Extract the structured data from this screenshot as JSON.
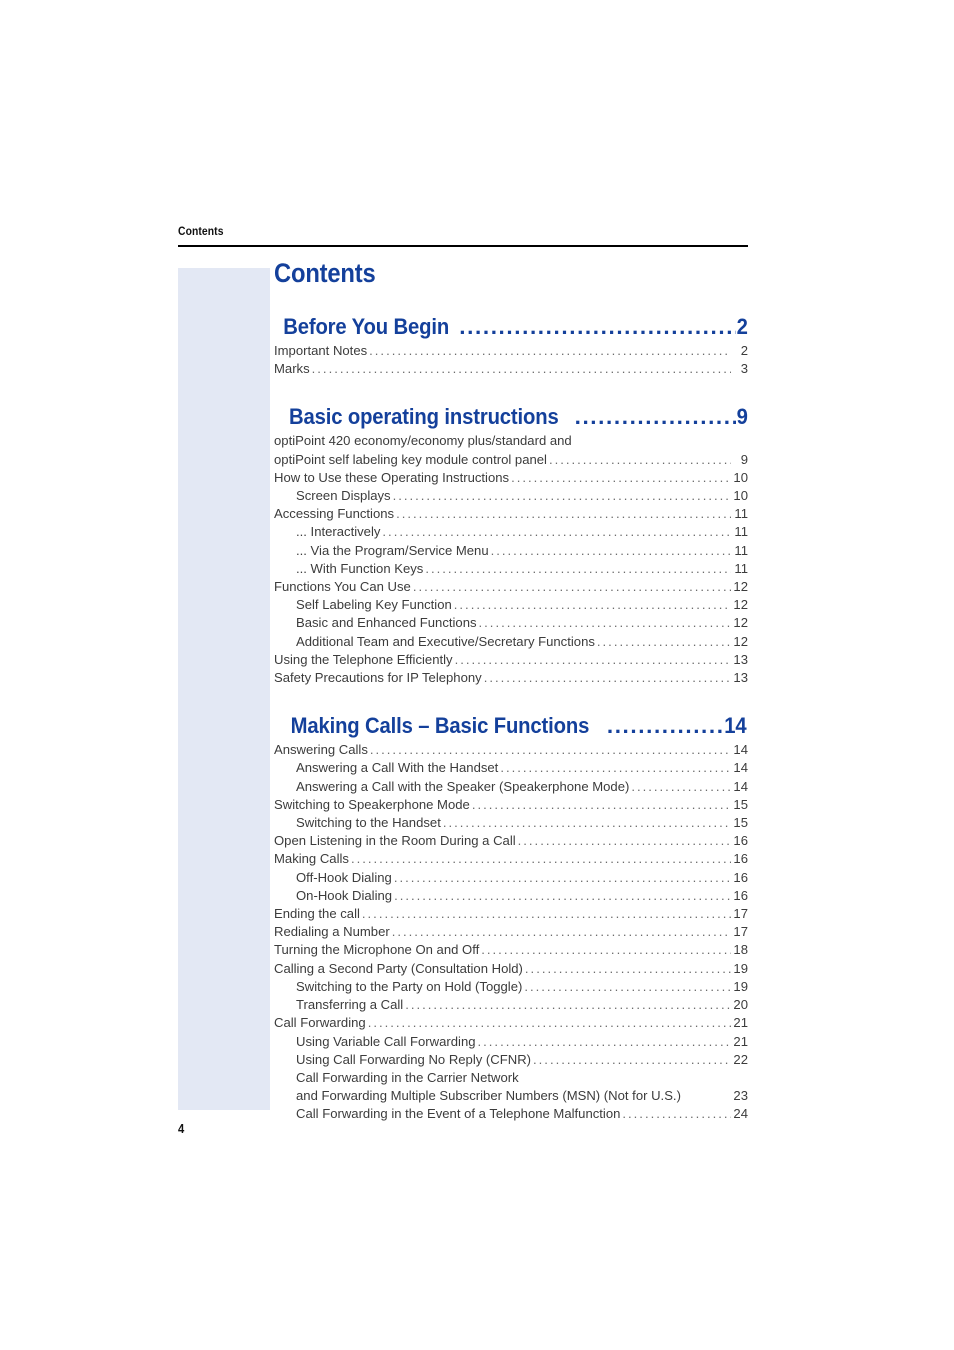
{
  "running_header": "Contents",
  "toc_title": "Contents",
  "folio": "4",
  "colors": {
    "heading_blue": "#14409B",
    "accent_band": "#E3E8F4",
    "body_text": "#3C3C3C",
    "rule": "#000000"
  },
  "parts": [
    {
      "title": "Before You Begin",
      "page": "2",
      "entries": [
        {
          "label": "Important Notes",
          "page": "2",
          "level": 1
        },
        {
          "label": "Marks",
          "page": "3",
          "level": 1
        }
      ]
    },
    {
      "title": "Basic operating instructions",
      "page": "9",
      "entries": [
        {
          "label": "optiPoint 420 economy/economy plus/standard and",
          "page": "",
          "level": 1,
          "dots": false
        },
        {
          "label": "optiPoint self labeling key module control panel",
          "page": "9",
          "level": 1
        },
        {
          "label": "How to Use these Operating Instructions",
          "page": "10",
          "level": 1
        },
        {
          "label": "Screen Displays",
          "page": "10",
          "level": 2
        },
        {
          "label": "Accessing Functions",
          "page": "11",
          "level": 1
        },
        {
          "label": "... Interactively",
          "page": "11",
          "level": 2
        },
        {
          "label": "... Via the Program/Service Menu",
          "page": "11",
          "level": 2
        },
        {
          "label": "... With Function Keys",
          "page": "11",
          "level": 2
        },
        {
          "label": "Functions You Can Use",
          "page": "12",
          "level": 1
        },
        {
          "label": "Self Labeling Key Function",
          "page": "12",
          "level": 2
        },
        {
          "label": "Basic and Enhanced Functions",
          "page": "12",
          "level": 2
        },
        {
          "label": "Additional Team and Executive/Secretary Functions",
          "page": "12",
          "level": 2
        },
        {
          "label": "Using the Telephone Efficiently",
          "page": "13",
          "level": 1
        },
        {
          "label": "Safety Precautions for IP Telephony",
          "page": "13",
          "level": 1
        }
      ]
    },
    {
      "title": "Making Calls – Basic Functions",
      "page": "14",
      "entries": [
        {
          "label": "Answering Calls",
          "page": "14",
          "level": 1
        },
        {
          "label": "Answering a Call With the Handset",
          "page": "14",
          "level": 2
        },
        {
          "label": "Answering a Call with the Speaker (Speakerphone Mode)",
          "page": "14",
          "level": 2
        },
        {
          "label": "Switching to Speakerphone Mode",
          "page": "15",
          "level": 1
        },
        {
          "label": "Switching to the Handset",
          "page": "15",
          "level": 2
        },
        {
          "label": "Open Listening in the Room During a Call",
          "page": "16",
          "level": 1
        },
        {
          "label": "Making Calls",
          "page": "16",
          "level": 1
        },
        {
          "label": "Off-Hook Dialing",
          "page": "16",
          "level": 2
        },
        {
          "label": "On-Hook Dialing",
          "page": "16",
          "level": 2
        },
        {
          "label": "Ending the call",
          "page": "17",
          "level": 1
        },
        {
          "label": "Redialing a Number",
          "page": "17",
          "level": 1
        },
        {
          "label": "Turning the Microphone On and Off",
          "page": "18",
          "level": 1
        },
        {
          "label": "Calling a Second Party (Consultation Hold)",
          "page": "19",
          "level": 1
        },
        {
          "label": "Switching to the Party on Hold (Toggle)",
          "page": "19",
          "level": 2
        },
        {
          "label": "Transferring a Call",
          "page": "20",
          "level": 2
        },
        {
          "label": "Call Forwarding",
          "page": "21",
          "level": 1
        },
        {
          "label": "Using Variable Call Forwarding",
          "page": "21",
          "level": 2
        },
        {
          "label": "Using Call Forwarding No Reply (CFNR)",
          "page": "22",
          "level": 2
        },
        {
          "label": "Call Forwarding in the Carrier Network",
          "page": "",
          "level": 2,
          "dots": false
        },
        {
          "label": "and Forwarding Multiple Subscriber Numbers (MSN) (Not for U.S.)",
          "page": "23",
          "level": 2,
          "dots": false
        },
        {
          "label": "Call Forwarding in the Event of a Telephone Malfunction",
          "page": "24",
          "level": 2
        }
      ]
    }
  ]
}
